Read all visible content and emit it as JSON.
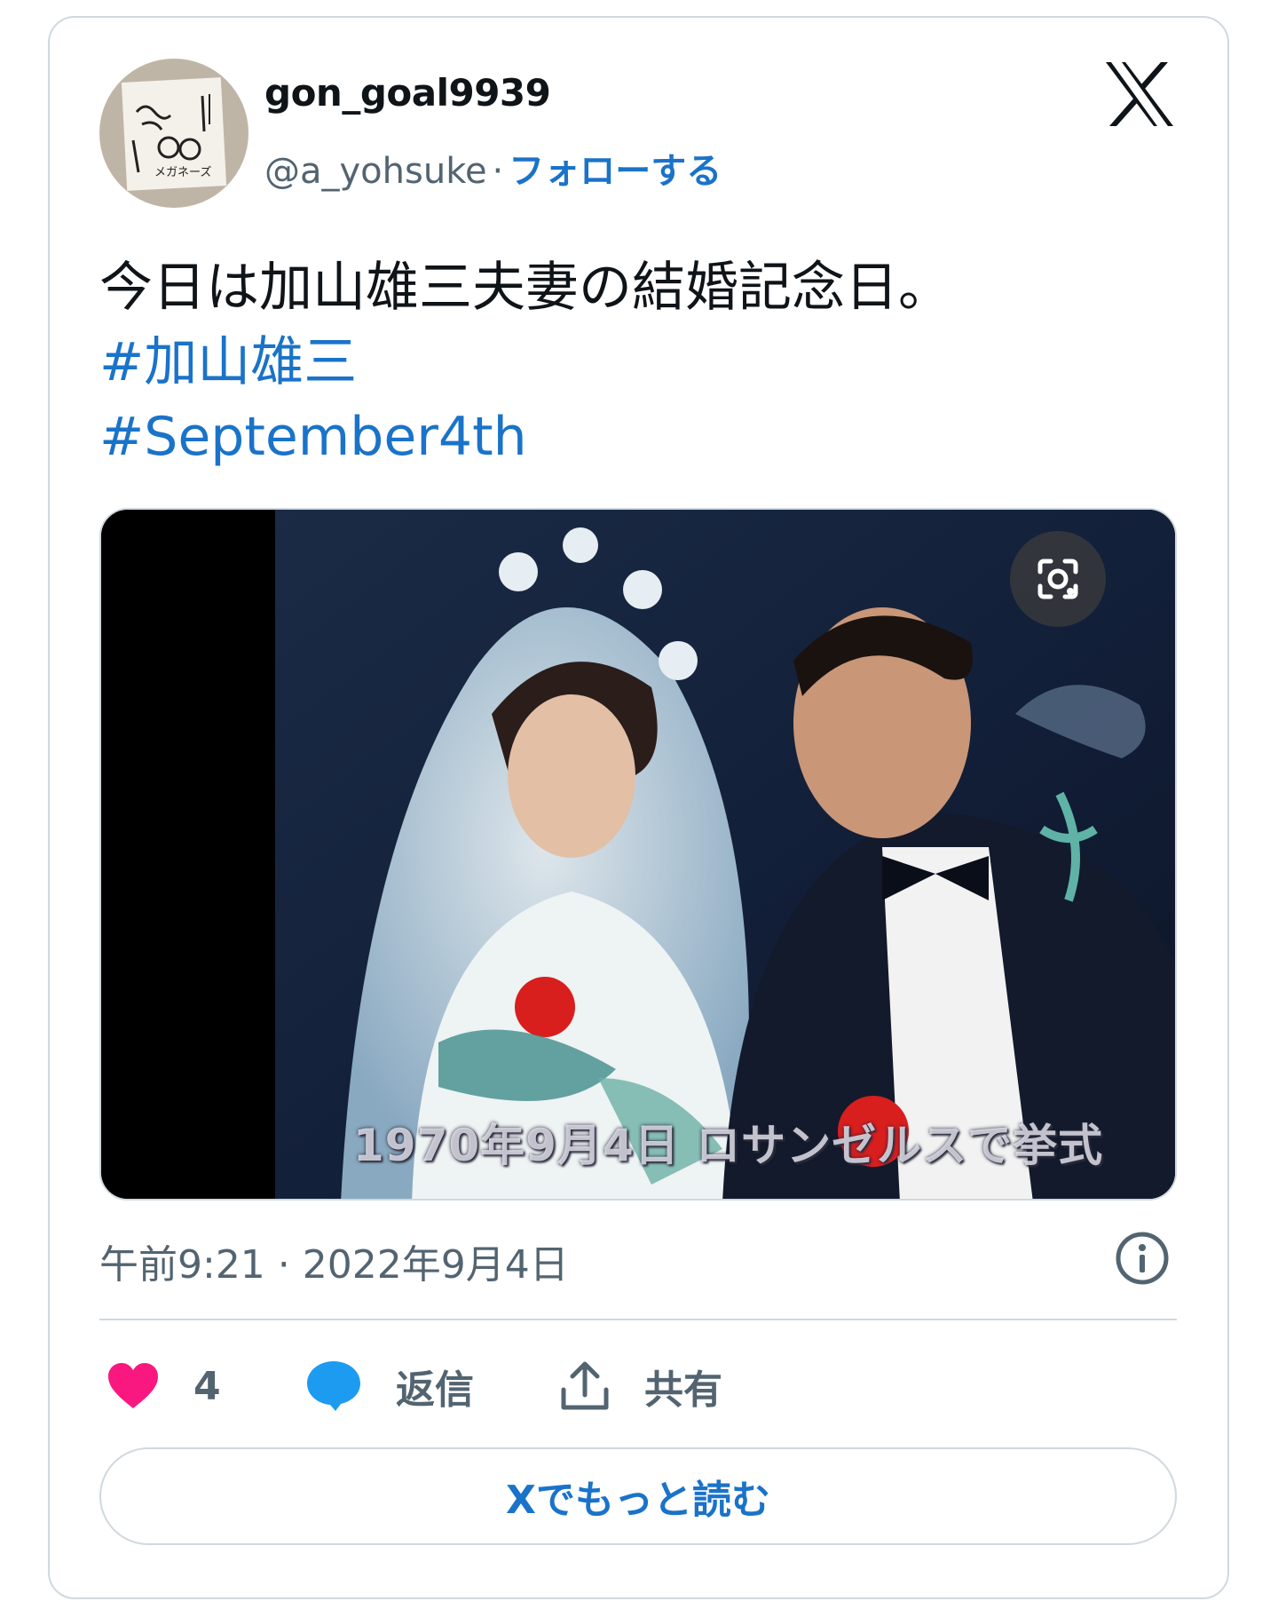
{
  "author": {
    "username": "gon_goal9939",
    "handle": "@a_yohsuke",
    "separator": "·",
    "follow_label": "フォローする",
    "avatar_text": "メガネーズ"
  },
  "tweet": {
    "text": "今日は加山雄三夫妻の結婚記念日。",
    "hashtags": [
      "#加山雄三",
      "#September4th"
    ]
  },
  "media": {
    "caption_overlay": "1970年9月4日 ロサンゼルスで挙式"
  },
  "meta": {
    "timestamp": "午前9:21 · 2022年9月4日"
  },
  "actions": {
    "like_count": "4",
    "reply_label": "返信",
    "share_label": "共有"
  },
  "read_more_label": "Xでもっと読む",
  "colors": {
    "link": "#1a73c9",
    "like": "#f91880",
    "reply": "#1d9bf0",
    "border": "#cfd9de",
    "muted": "#536471"
  },
  "icons": [
    "x-logo-icon",
    "lens-icon",
    "info-icon",
    "heart-icon",
    "speech-bubble-icon",
    "share-icon"
  ]
}
